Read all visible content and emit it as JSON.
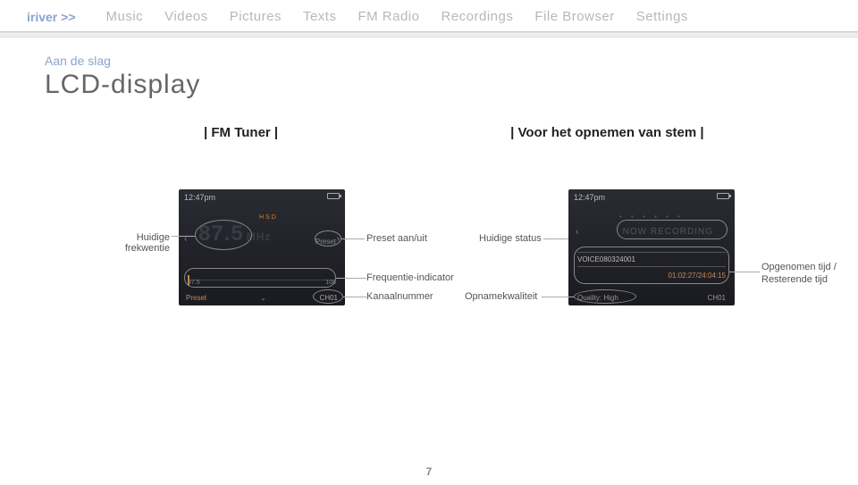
{
  "nav": {
    "brand": "iriver >>",
    "items": [
      "Music",
      "Videos",
      "Pictures",
      "Texts",
      "FM Radio",
      "Recordings",
      "File Browser",
      "Settings"
    ]
  },
  "breadcrumb": "Aan de slag",
  "page_title": "LCD-display",
  "sections": {
    "fm": "| FM Tuner |",
    "voice": "| Voor het opnemen van stem |"
  },
  "fm_screen": {
    "time": "12:47pm",
    "freq": "87.5",
    "unit": "MHz",
    "hd": "H S D",
    "preset_label": "Preset",
    "scale_low": "87.5",
    "scale_high": "108",
    "bottom_left": "Preset",
    "bottom_right": "CH01"
  },
  "voice_screen": {
    "time": "12:47pm",
    "status": "NOW RECORDING",
    "dots": "• • • • • •",
    "file": "VOICE080324001",
    "elapsed": "01:02:27/24:04:15",
    "quality_label": "Quality: High",
    "channel": "CH01"
  },
  "annotations": {
    "huidige_frekwentie": "Huidige frekwentie",
    "preset_aan_uit": "Preset aan/uit",
    "frequentie_indicator": "Frequentie-indicator",
    "kanaalnummer": "Kanaalnummer",
    "huidige_status": "Huidige status",
    "opnamekwaliteit": "Opnamekwaliteit",
    "opgenomen_tijd": "Opgenomen tijd / Resterende tijd"
  },
  "page_number": "7"
}
